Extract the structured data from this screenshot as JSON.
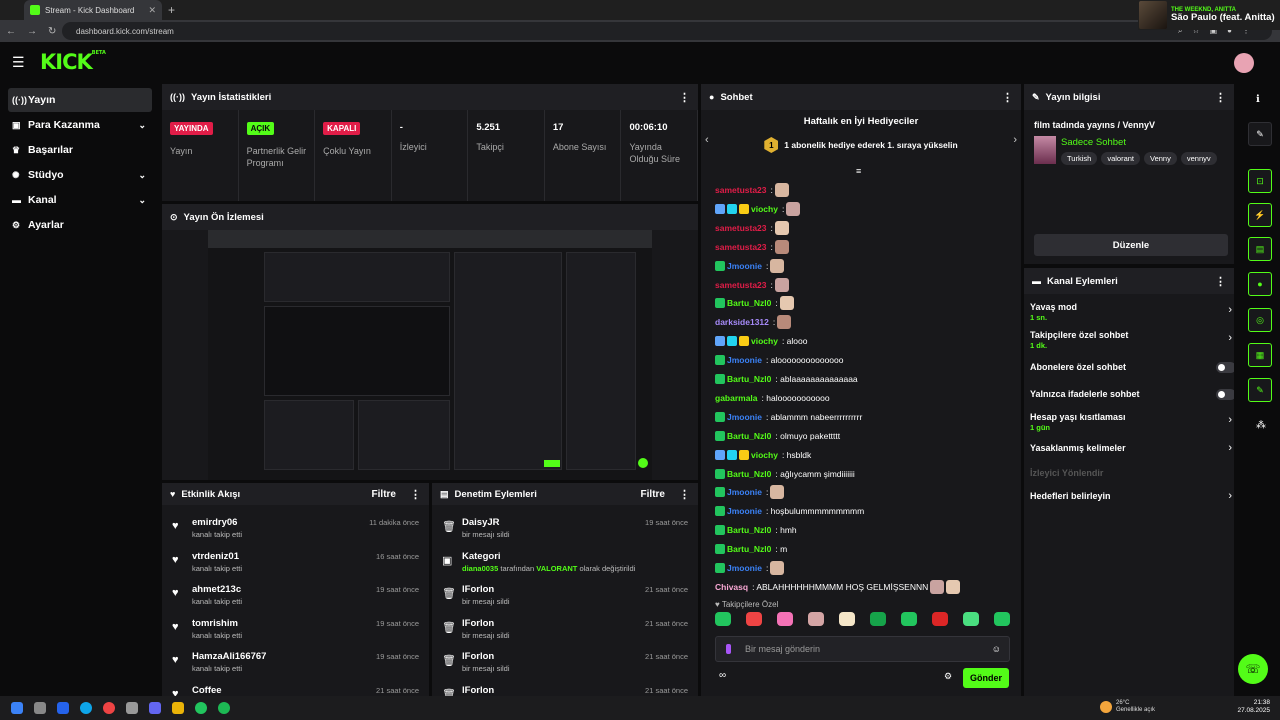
{
  "browser": {
    "tab_title": "Stream - Kick Dashboard",
    "url": "dashboard.kick.com/stream"
  },
  "media": {
    "artist": "THE WEEKND, ANITTA",
    "song": "São Paulo (feat. Anitta)"
  },
  "logo": {
    "text": "KICK",
    "beta": "BETA"
  },
  "sidebar": [
    {
      "label": "Yayın",
      "icon": "broadcast-icon",
      "active": true
    },
    {
      "label": "Para Kazanma",
      "icon": "money-icon",
      "chev": true
    },
    {
      "label": "Başarılar",
      "icon": "trophy-icon"
    },
    {
      "label": "Stüdyo",
      "icon": "studio-icon",
      "chev": true
    },
    {
      "label": "Kanal",
      "icon": "channel-icon",
      "chev": true
    },
    {
      "label": "Ayarlar",
      "icon": "gear-icon"
    }
  ],
  "stats": {
    "title": "Yayın İstatistikleri",
    "items": [
      {
        "badge": "YAYINDA",
        "badge_color": "#e11d48",
        "badge_text": "#ffffff",
        "label": "Yayın"
      },
      {
        "badge": "AÇIK",
        "badge_color": "#53fc18",
        "badge_text": "#0b0b0c",
        "label": "Partnerlik Gelir Programı"
      },
      {
        "badge": "KAPALI",
        "badge_color": "#e11d48",
        "badge_text": "#ffffff",
        "label": "Çoklu Yayın"
      },
      {
        "value": "-",
        "label": "İzleyici"
      },
      {
        "value": "5.251",
        "label": "Takipçi"
      },
      {
        "value": "17",
        "label": "Abone Sayısı"
      },
      {
        "value": "00:06:10",
        "label": "Yayında Olduğu Süre"
      }
    ]
  },
  "preview": {
    "title": "Yayın Ön İzlemesi"
  },
  "activity": {
    "title": "Etkinlik Akışı",
    "filter": "Filtre",
    "items": [
      {
        "name": "emirdry06",
        "sub": "kanalı takip etti",
        "time": "11 dakika önce"
      },
      {
        "name": "vtrdeniz01",
        "sub": "kanalı takip etti",
        "time": "16 saat önce"
      },
      {
        "name": "ahmet213c",
        "sub": "kanalı takip etti",
        "time": "19 saat önce"
      },
      {
        "name": "tomrishim",
        "sub": "kanalı takip etti",
        "time": "19 saat önce"
      },
      {
        "name": "HamzaAli166767",
        "sub": "kanalı takip etti",
        "time": "19 saat önce"
      },
      {
        "name": "Coffee",
        "sub": "",
        "time": "21 saat önce"
      }
    ]
  },
  "moderation": {
    "title": "Denetim Eylemleri",
    "filter": "Filtre",
    "items": [
      {
        "name": "DaisyJR",
        "sub": "bir mesajı sildi",
        "time": "19 saat önce",
        "icon": "trash-icon"
      },
      {
        "name": "Kategori",
        "sub_user": "diana0035",
        "sub_mid": "tarafından",
        "sub_cat": "VALORANT",
        "sub_end": "olarak değiştirildi",
        "time": "",
        "icon": "category-icon"
      },
      {
        "name": "lForlon",
        "sub": "bir mesajı sildi",
        "time": "21 saat önce",
        "icon": "trash-icon"
      },
      {
        "name": "lForlon",
        "sub": "bir mesajı sildi",
        "time": "21 saat önce",
        "icon": "trash-icon"
      },
      {
        "name": "lForlon",
        "sub": "bir mesajı sildi",
        "time": "21 saat önce",
        "icon": "trash-icon"
      },
      {
        "name": "lForlon",
        "sub": "",
        "time": "21 saat önce",
        "icon": "trash-icon"
      }
    ]
  },
  "chat": {
    "title": "Sohbet",
    "top_gifters": "Haftalık en İyi Hediyeciler",
    "gift_num": "1",
    "gift_text": "1 abonelik hediye ederek 1. sıraya yükselin",
    "messages": [
      {
        "user": "sametusta23",
        "color": "#e11d48",
        "text": ":",
        "badges": 0,
        "emotes": 1
      },
      {
        "user": "viochy",
        "color": "#53fc18",
        "text": ":",
        "badges": 3,
        "emotes": 1
      },
      {
        "user": "sametusta23",
        "color": "#e11d48",
        "text": ":",
        "badges": 0,
        "emotes": 1
      },
      {
        "user": "sametusta23",
        "color": "#e11d48",
        "text": ":",
        "badges": 0,
        "emotes": 1
      },
      {
        "user": "Jmoonie",
        "color": "#3b82f6",
        "text": ":",
        "badges": 1,
        "emotes": 1
      },
      {
        "user": "sametusta23",
        "color": "#e11d48",
        "text": ":",
        "badges": 0,
        "emotes": 1
      },
      {
        "user": "Bartu_Nzl0",
        "color": "#53fc18",
        "text": ":",
        "badges": 1,
        "emotes": 1
      },
      {
        "user": "darkside1312",
        "color": "#a78bfa",
        "text": ":",
        "badges": 0,
        "emotes": 1
      },
      {
        "user": "viochy",
        "color": "#53fc18",
        "text": ": alooo",
        "badges": 3,
        "emotes": 0
      },
      {
        "user": "Jmoonie",
        "color": "#3b82f6",
        "text": ": aloooooooooooooo",
        "badges": 1,
        "emotes": 0
      },
      {
        "user": "Bartu_Nzl0",
        "color": "#53fc18",
        "text": ": ablaaaaaaaaaaaaaa",
        "badges": 1,
        "emotes": 0
      },
      {
        "user": "gabarmala",
        "color": "#53fc18",
        "text": ": halooooooooooo",
        "badges": 0,
        "emotes": 0
      },
      {
        "user": "Jmoonie",
        "color": "#3b82f6",
        "text": ": ablammm nabeerrrrrrrrrr",
        "badges": 1,
        "emotes": 0
      },
      {
        "user": "Bartu_Nzl0",
        "color": "#53fc18",
        "text": ": olmuyo pakettttt",
        "badges": 1,
        "emotes": 0
      },
      {
        "user": "viochy",
        "color": "#53fc18",
        "text": ": hsbldk",
        "badges": 3,
        "emotes": 0
      },
      {
        "user": "Bartu_Nzl0",
        "color": "#53fc18",
        "text": ": ağlıycamm şimdiiiiiii",
        "badges": 1,
        "emotes": 0
      },
      {
        "user": "Jmoonie",
        "color": "#3b82f6",
        "text": ":",
        "badges": 1,
        "emotes": 1
      },
      {
        "user": "Jmoonie",
        "color": "#3b82f6",
        "text": ": hoşbulummmmmmmmm",
        "badges": 1,
        "emotes": 0
      },
      {
        "user": "Bartu_Nzl0",
        "color": "#53fc18",
        "text": ": hmh",
        "badges": 1,
        "emotes": 0
      },
      {
        "user": "Bartu_Nzl0",
        "color": "#53fc18",
        "text": ": m",
        "badges": 1,
        "emotes": 0
      },
      {
        "user": "Jmoonie",
        "color": "#3b82f6",
        "text": ":",
        "badges": 1,
        "emotes": 1
      },
      {
        "user": "Chivasq",
        "color": "#f9a8d4",
        "text": ": ABLAHHHHHHMMMM HOŞ GELMİŞSENNN",
        "badges": 0,
        "emotes": 2
      }
    ],
    "emote_section": "Takipçilere Özel",
    "placeholder": "Bir mesaj gönderin",
    "send": "Gönder"
  },
  "stream_info": {
    "title": "Yayın bilgisi",
    "stream_title": "film tadında yayıns / VennyV",
    "category": "Sadece Sohbet",
    "tags": [
      "Turkish",
      "valorant",
      "Venny",
      "vennyv"
    ],
    "edit": "Düzenle"
  },
  "channel_actions": {
    "title": "Kanal Eylemleri",
    "items": [
      {
        "label": "Yavaş mod",
        "sub": "1 sn.",
        "type": "chev"
      },
      {
        "label": "Takipçilere özel sohbet",
        "sub": "1 dk.",
        "type": "chev"
      },
      {
        "label": "Abonelere özel sohbet",
        "sub": "",
        "type": "toggle"
      },
      {
        "label": "Yalnızca ifadelerle sohbet",
        "sub": "",
        "type": "toggle"
      },
      {
        "label": "Hesap yaşı kısıtlaması",
        "sub": "1 gün",
        "type": "chev"
      },
      {
        "label": "Yasaklanmış kelimeler",
        "sub": "",
        "type": "chev"
      },
      {
        "label": "İzleyici Yönlendir",
        "sub": "",
        "type": "disabled"
      },
      {
        "label": "Hedefleri belirleyin",
        "sub": "",
        "type": "chev"
      }
    ]
  },
  "taskbar": {
    "temp": "26°C",
    "weather": "Genellikle açık",
    "time": "21:38",
    "date": "27.08.2025"
  }
}
